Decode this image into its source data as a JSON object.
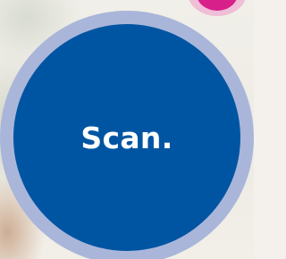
{
  "cta": {
    "label": "Scan."
  },
  "colors": {
    "circle_fill": "#0055a2",
    "ring": "#a9b6da",
    "accent_pink": "#d8208a",
    "text": "#ffffff"
  }
}
